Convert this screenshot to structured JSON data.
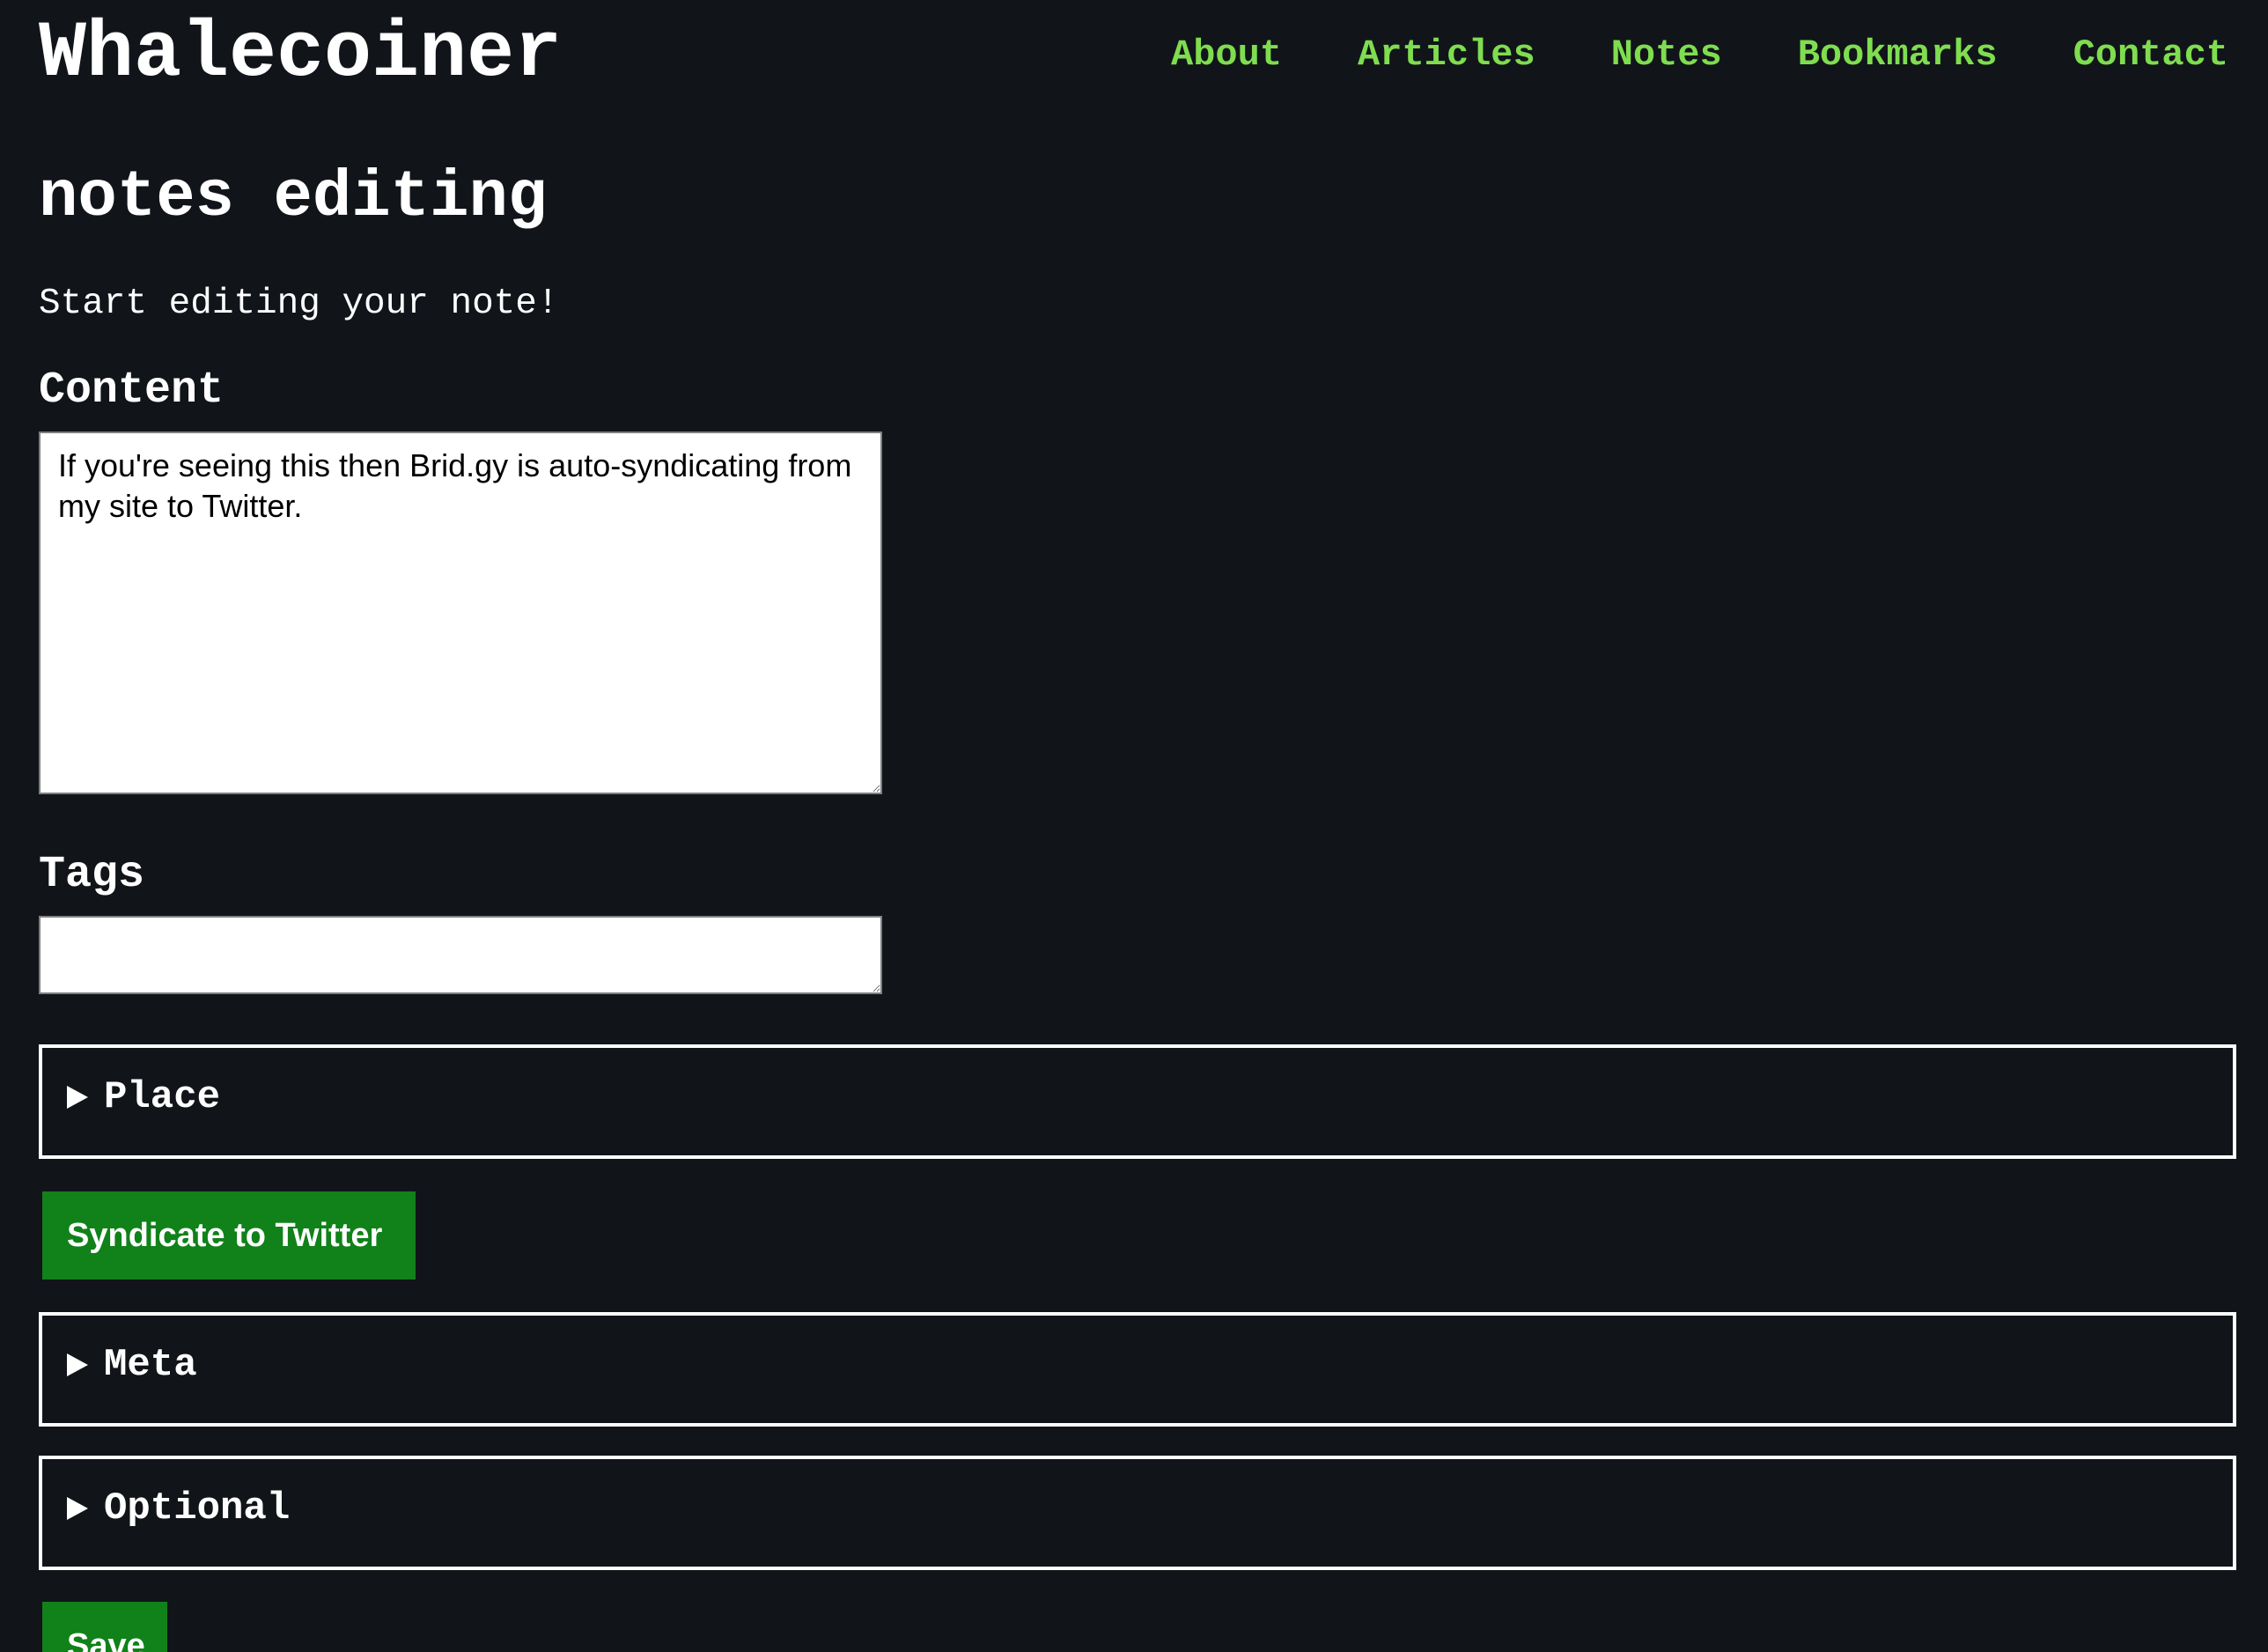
{
  "header": {
    "site_title": "Whalecoiner",
    "nav": [
      {
        "label": "About"
      },
      {
        "label": "Articles"
      },
      {
        "label": "Notes"
      },
      {
        "label": "Bookmarks"
      },
      {
        "label": "Contact"
      }
    ]
  },
  "main": {
    "title": "notes editing",
    "intro": "Start editing your note!",
    "content": {
      "label": "Content",
      "value": "If you're seeing this then Brid.gy is auto-syndicating from my site to Twitter."
    },
    "tags": {
      "label": "Tags",
      "value": ""
    },
    "sections": {
      "place": "Place",
      "meta": "Meta",
      "optional": "Optional"
    },
    "buttons": {
      "syndicate": "Syndicate to Twitter",
      "save": "Save"
    }
  },
  "colors": {
    "background": "#11151a",
    "text": "#ffffff",
    "nav_link": "#7fdd4f",
    "button": "#11811a"
  },
  "icons": {
    "collapsed_section": "triangle-right-icon"
  }
}
